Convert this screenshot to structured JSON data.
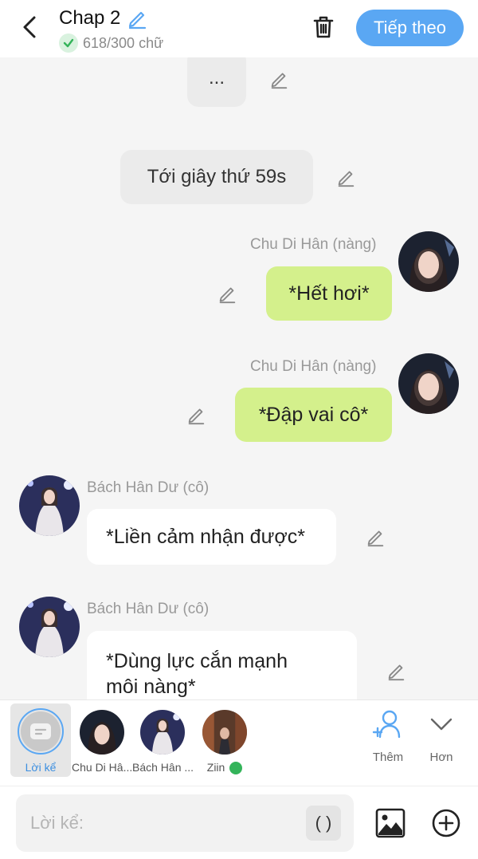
{
  "header": {
    "title": "Chap 2",
    "word_count": "618/300 chữ",
    "next_label": "Tiếp theo"
  },
  "messages": [
    {
      "type": "narration",
      "text": "..."
    },
    {
      "type": "narration",
      "text": "Tới giây thứ 59s"
    },
    {
      "type": "right",
      "sender": "Chu Di Hân (nàng)",
      "text": "*Hết hơi*"
    },
    {
      "type": "right",
      "sender": "Chu Di Hân (nàng)",
      "text": "*Đập vai cô*"
    },
    {
      "type": "left",
      "sender": "Bách Hân Dư (cô)",
      "text": "*Liền cảm nhận được*"
    },
    {
      "type": "left",
      "sender": "Bách Hân Dư (cô)",
      "text_line1": "*Dùng lực cắn mạnh",
      "text_line2": "môi nàng*"
    }
  ],
  "characters": [
    {
      "label": "Lời kể",
      "selected": true
    },
    {
      "label": "Chu Di Hâ..."
    },
    {
      "label": "Bách Hân ..."
    },
    {
      "label": "Ziin"
    }
  ],
  "actions": {
    "add_label": "Thêm",
    "more_label": "Hơn"
  },
  "input": {
    "placeholder": "Lời kể:",
    "paren_label": "( )"
  },
  "colors": {
    "accent": "#5aa7f3",
    "green_bubble": "#d4f08c",
    "check": "#34b45a"
  }
}
